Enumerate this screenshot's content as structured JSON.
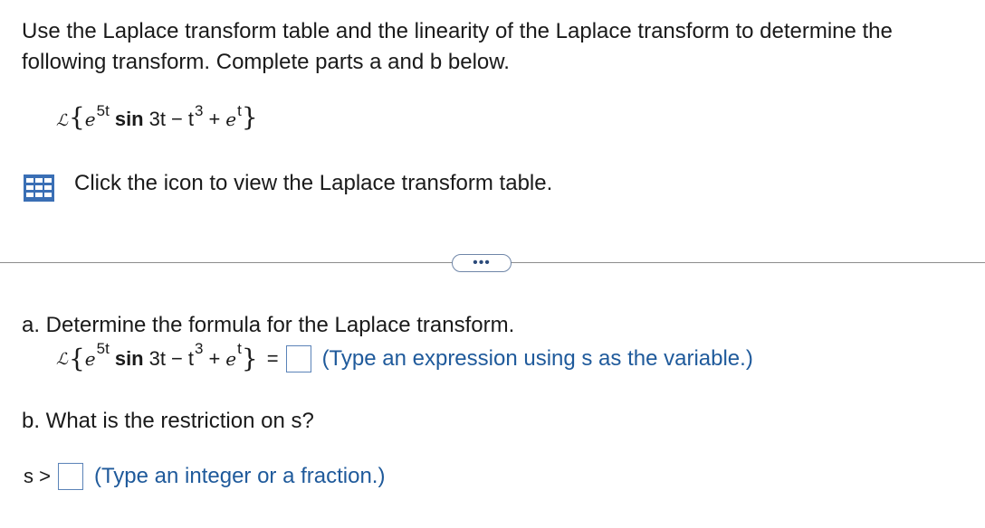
{
  "question": {
    "intro": "Use the Laplace transform table and the linearity of the Laplace transform to determine the following transform. Complete parts a and b below.",
    "expression": {
      "operator": "ℒ",
      "open_brace": "{",
      "close_brace": "}",
      "base_e": "e",
      "exp_5t": "5t",
      "sin_term": "sin",
      "arg_3t": "3t",
      "minus": "−",
      "t": "t",
      "exp_3": "3",
      "plus": "+",
      "exp_t": "t"
    }
  },
  "table_link": {
    "text": "Click the icon to view the Laplace transform table.",
    "icon": "table-icon"
  },
  "more_button": {
    "label": "•••"
  },
  "part_a": {
    "prompt": "a. Determine the formula for the Laplace transform.",
    "equals": "=",
    "hint": "(Type an expression using s as the variable.)"
  },
  "part_b": {
    "prompt": "b. What is the restriction on s?",
    "var_label": "s >",
    "hint": "(Type an integer or a fraction.)"
  },
  "colors": {
    "link_blue": "#1f5a9b",
    "box_border": "#5b83b8",
    "icon_blue": "#3a6fb5"
  }
}
